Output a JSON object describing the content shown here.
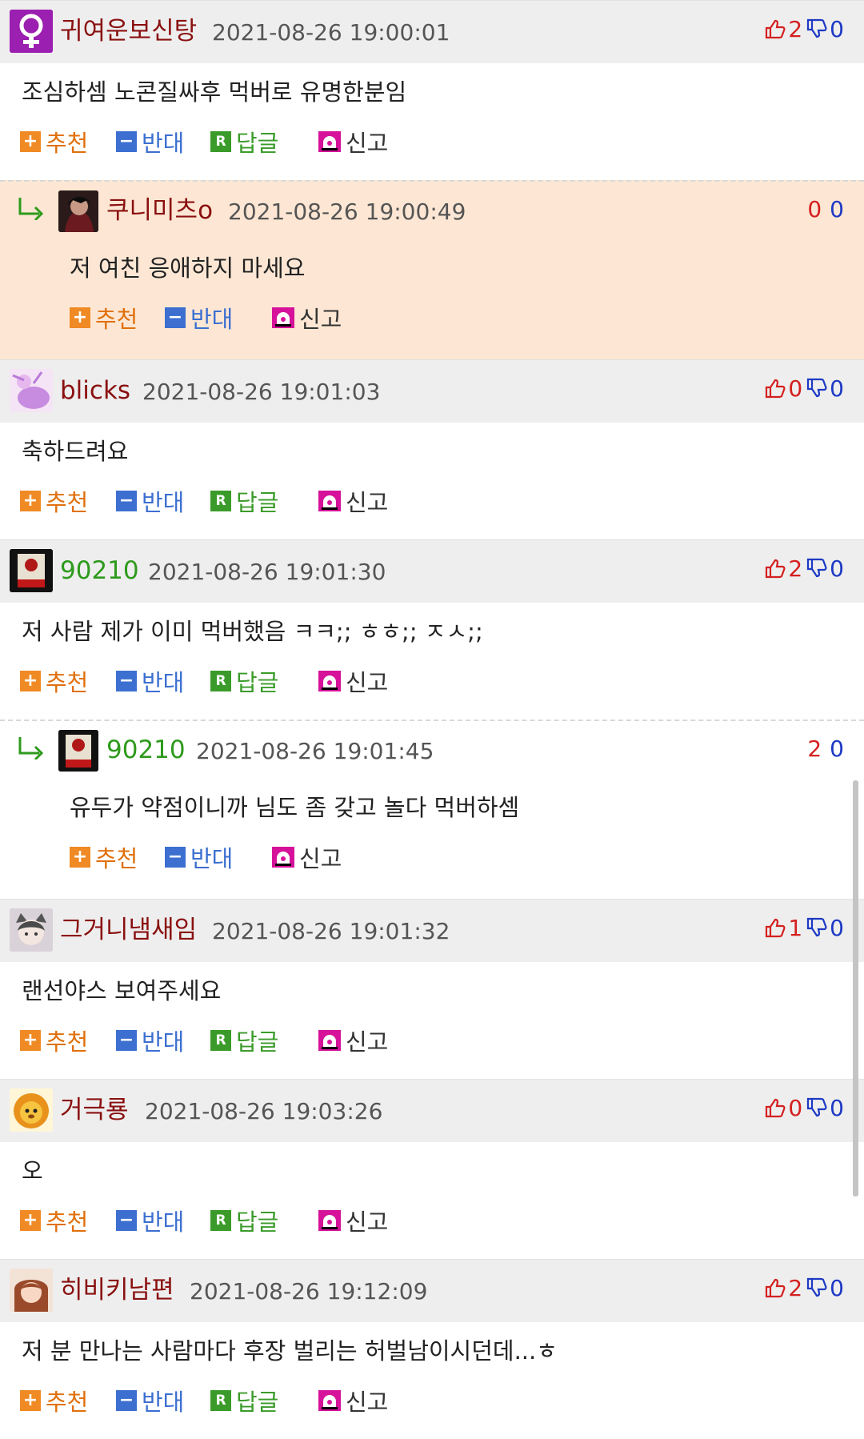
{
  "labels": {
    "recommend": "추천",
    "oppose": "반대",
    "reply": "답글",
    "report": "신고"
  },
  "icons": {
    "recommend": "plus-icon",
    "oppose": "minus-icon",
    "reply": "reply-r-icon",
    "report": "siren-icon",
    "thumb_up": "thumbs-up-icon",
    "thumb_down": "thumbs-down-icon",
    "reply_arrow": "reply-arrow-icon"
  },
  "colors": {
    "nick": "#8a1010",
    "nick_green": "#2e9a1c",
    "up": "#d42020",
    "down": "#1d39c4",
    "reply_highlight": "#fde7d4",
    "header_bg": "#eeeeee"
  },
  "comments": [
    {
      "nick": "귀여운보신탕",
      "date": "2021-08-26 19:00:01",
      "up": "2",
      "down": "0",
      "text": "조심하셈 노콘질싸후 먹버로 유명한분임",
      "replies": [
        {
          "nick": "쿠니미츠o",
          "date": "2021-08-26 19:00:49",
          "up": "0",
          "down": "0",
          "text": "저 여친 응애하지 마세요"
        }
      ]
    },
    {
      "nick": "blicks",
      "date": "2021-08-26 19:01:03",
      "up": "0",
      "down": "0",
      "text": "축하드려요",
      "replies": []
    },
    {
      "nick": "90210",
      "date": "2021-08-26 19:01:30",
      "up": "2",
      "down": "0",
      "text": "저 사람 제가 이미 먹버했음 ㅋㅋ;; ㅎㅎ;; ㅈㅅ;;",
      "replies": [
        {
          "nick": "90210",
          "date": "2021-08-26 19:01:45",
          "up": "2",
          "down": "0",
          "text": "유두가 약점이니까 님도 좀 갖고 놀다 먹버하셈"
        }
      ]
    },
    {
      "nick": "그거니냄새임",
      "date": "2021-08-26 19:01:32",
      "up": "1",
      "down": "0",
      "text": "랜선야스 보여주세요",
      "replies": []
    },
    {
      "nick": "거극룡",
      "date": "2021-08-26 19:03:26",
      "up": "0",
      "down": "0",
      "text": "오",
      "replies": []
    },
    {
      "nick": "히비키남편",
      "date": "2021-08-26 19:12:09",
      "up": "2",
      "down": "0",
      "text": "저 분 만나는 사람마다 후장 벌리는 허벌남이시던데...ㅎ",
      "replies": []
    }
  ]
}
